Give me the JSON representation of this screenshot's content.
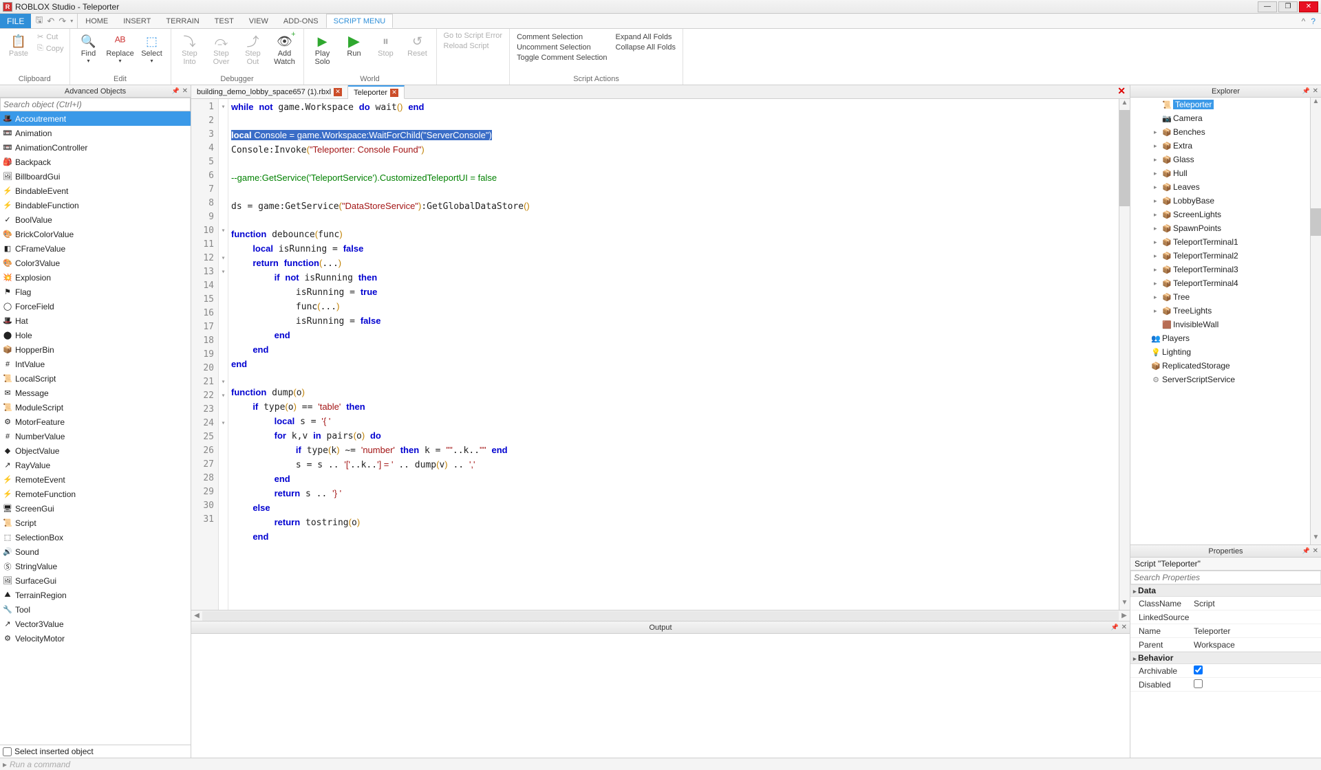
{
  "title": "ROBLOX Studio - Teleporter",
  "file_button": "FILE",
  "menu_tabs": [
    "HOME",
    "INSERT",
    "TERRAIN",
    "TEST",
    "VIEW",
    "ADD-ONS",
    "SCRIPT MENU"
  ],
  "menu_active": 6,
  "ribbon": {
    "clipboard": {
      "label": "Clipboard",
      "paste": "Paste",
      "cut": "Cut",
      "copy": "Copy"
    },
    "edit": {
      "label": "Edit",
      "find": "Find",
      "replace": "Replace",
      "select": "Select"
    },
    "debugger": {
      "label": "Debugger",
      "step_into": "Step\nInto",
      "step_over": "Step\nOver",
      "step_out": "Step\nOut",
      "add_watch": "Add\nWatch"
    },
    "world": {
      "label": "World",
      "play_solo": "Play\nSolo",
      "run": "Run",
      "stop": "Stop",
      "reset": "Reset"
    },
    "nav": {
      "go_to_error": "Go to Script Error",
      "reload": "Reload Script"
    },
    "comment": {
      "comment": "Comment Selection",
      "uncomment": "Uncomment Selection",
      "toggle": "Toggle Comment Selection",
      "label": "Script Actions"
    },
    "folds": {
      "expand": "Expand All Folds",
      "collapse": "Collapse All Folds"
    }
  },
  "adv_objects": {
    "title": "Advanced Objects",
    "search_ph": "Search object (Ctrl+I)",
    "items": [
      "Accoutrement",
      "Animation",
      "AnimationController",
      "Backpack",
      "BillboardGui",
      "BindableEvent",
      "BindableFunction",
      "BoolValue",
      "BrickColorValue",
      "CFrameValue",
      "Color3Value",
      "Explosion",
      "Flag",
      "ForceField",
      "Hat",
      "Hole",
      "HopperBin",
      "IntValue",
      "LocalScript",
      "Message",
      "ModuleScript",
      "MotorFeature",
      "NumberValue",
      "ObjectValue",
      "RayValue",
      "RemoteEvent",
      "RemoteFunction",
      "ScreenGui",
      "Script",
      "SelectionBox",
      "Sound",
      "StringValue",
      "SurfaceGui",
      "TerrainRegion",
      "Tool",
      "Vector3Value",
      "VelocityMotor"
    ],
    "selected": 0,
    "checkbox": "Select inserted object"
  },
  "doc_tabs": [
    {
      "label": "building_demo_lobby_space657 (1).rbxl",
      "active": false
    },
    {
      "label": "Teleporter",
      "active": true
    }
  ],
  "code_lines": 31,
  "explorer": {
    "title": "Explorer",
    "items": [
      {
        "indent": 2,
        "label": "Teleporter",
        "icon": "script",
        "selected": true
      },
      {
        "indent": 2,
        "label": "Camera",
        "icon": "cam"
      },
      {
        "indent": 2,
        "label": "Benches",
        "icon": "model",
        "tw": "▸"
      },
      {
        "indent": 2,
        "label": "Extra",
        "icon": "model",
        "tw": "▸"
      },
      {
        "indent": 2,
        "label": "Glass",
        "icon": "model",
        "tw": "▸"
      },
      {
        "indent": 2,
        "label": "Hull",
        "icon": "model",
        "tw": "▸"
      },
      {
        "indent": 2,
        "label": "Leaves",
        "icon": "model",
        "tw": "▸"
      },
      {
        "indent": 2,
        "label": "LobbyBase",
        "icon": "model",
        "tw": "▸"
      },
      {
        "indent": 2,
        "label": "ScreenLights",
        "icon": "model",
        "tw": "▸"
      },
      {
        "indent": 2,
        "label": "SpawnPoints",
        "icon": "model",
        "tw": "▸"
      },
      {
        "indent": 2,
        "label": "TeleportTerminal1",
        "icon": "model",
        "tw": "▸"
      },
      {
        "indent": 2,
        "label": "TeleportTerminal2",
        "icon": "model",
        "tw": "▸"
      },
      {
        "indent": 2,
        "label": "TeleportTerminal3",
        "icon": "model",
        "tw": "▸"
      },
      {
        "indent": 2,
        "label": "TeleportTerminal4",
        "icon": "model",
        "tw": "▸"
      },
      {
        "indent": 2,
        "label": "Tree",
        "icon": "model",
        "tw": "▸"
      },
      {
        "indent": 2,
        "label": "TreeLights",
        "icon": "model",
        "tw": "▸"
      },
      {
        "indent": 2,
        "label": "InvisibleWall",
        "icon": "cube"
      },
      {
        "indent": 1,
        "label": "Players",
        "icon": "ppl"
      },
      {
        "indent": 1,
        "label": "Lighting",
        "icon": "light"
      },
      {
        "indent": 1,
        "label": "ReplicatedStorage",
        "icon": "box"
      },
      {
        "indent": 1,
        "label": "ServerScriptService",
        "icon": "gear"
      }
    ]
  },
  "properties": {
    "title": "Properties",
    "sub": "Script \"Teleporter\"",
    "search_ph": "Search Properties",
    "sections": [
      {
        "name": "Data",
        "rows": [
          {
            "k": "ClassName",
            "v": "Script"
          },
          {
            "k": "LinkedSource",
            "v": ""
          },
          {
            "k": "Name",
            "v": "Teleporter"
          },
          {
            "k": "Parent",
            "v": "Workspace"
          }
        ]
      },
      {
        "name": "Behavior",
        "rows": [
          {
            "k": "Archivable",
            "v": "checkbox",
            "checked": true
          },
          {
            "k": "Disabled",
            "v": "checkbox",
            "checked": false
          }
        ]
      }
    ]
  },
  "output_title": "Output",
  "command_ph": "Run a command"
}
